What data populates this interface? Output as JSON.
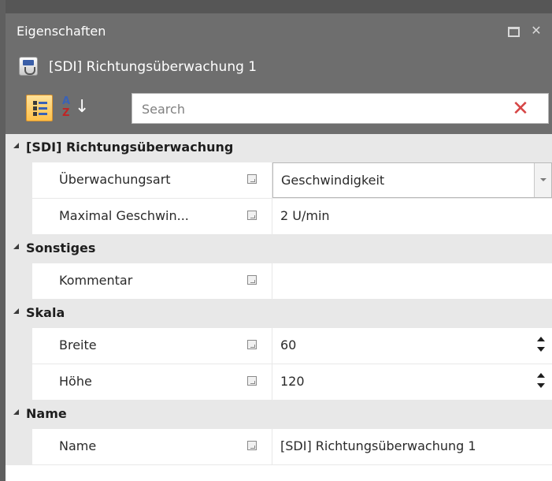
{
  "panel": {
    "title": "Eigenschaften",
    "close_glyph": "✕"
  },
  "object": {
    "title": "[SDI] Richtungsüberwachung 1",
    "icon": "sdi-object-icon"
  },
  "toolbar": {
    "categorized_icon": "categorized-view-icon",
    "alphabetical_icon": "sort-az-icon",
    "alpha_top": "A",
    "alpha_bottom": "Z",
    "alpha_arrow": "↓",
    "search_placeholder": "Search",
    "search_value": "",
    "clear_glyph": "✕"
  },
  "categories": [
    {
      "label": "[SDI] Richtungsüberwachung",
      "properties": [
        {
          "name": "Überwachungsart",
          "value": "Geschwindigkeit",
          "editor": "dropdown"
        },
        {
          "name": "Maximal Geschwin...",
          "value": "2 U/min",
          "editor": "text"
        }
      ]
    },
    {
      "label": "Sonstiges",
      "properties": [
        {
          "name": "Kommentar",
          "value": "",
          "editor": "text"
        }
      ]
    },
    {
      "label": "Skala",
      "properties": [
        {
          "name": "Breite",
          "value": "60",
          "editor": "spinner"
        },
        {
          "name": "Höhe",
          "value": "120",
          "editor": "spinner"
        }
      ]
    },
    {
      "label": "Name",
      "properties": [
        {
          "name": "Name",
          "value": "[SDI] Richtungsüberwachung 1",
          "editor": "text"
        }
      ]
    }
  ],
  "colors": {
    "header_background": "#6e6e6e",
    "category_background": "#e8e8e8",
    "active_tool": "#ffc14a",
    "clear_icon": "#d64545"
  }
}
